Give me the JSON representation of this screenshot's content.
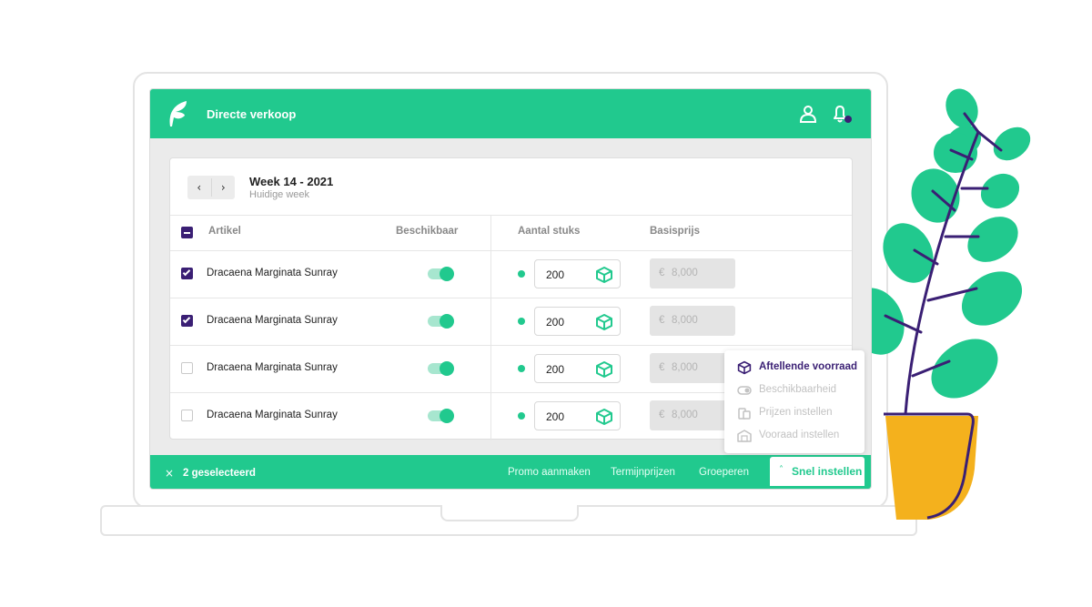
{
  "app": {
    "title": "Directe verkoop"
  },
  "week": {
    "title": "Week 14 - 2021",
    "subtitle": "Huidige week",
    "prev": "‹",
    "next": "›"
  },
  "table": {
    "columns": [
      "Artikel",
      "Beschikbaar",
      "Aantal stuks",
      "Basisprijs"
    ],
    "rows": [
      {
        "selected": true,
        "name": "Dracaena Marginata Sunray",
        "available": true,
        "quantity": "200",
        "currency": "€",
        "price": "8,000"
      },
      {
        "selected": true,
        "name": "Dracaena Marginata Sunray",
        "available": true,
        "quantity": "200",
        "currency": "€",
        "price": "8,000"
      },
      {
        "selected": false,
        "name": "Dracaena Marginata Sunray",
        "available": true,
        "quantity": "200",
        "currency": "€",
        "price": "8,000"
      },
      {
        "selected": false,
        "name": "Dracaena Marginata Sunray",
        "available": true,
        "quantity": "200",
        "currency": "€",
        "price": "8,000"
      }
    ]
  },
  "bottombar": {
    "close": "×",
    "selected": "2 geselecteerd",
    "links": [
      "Promo aanmaken",
      "Termijnprijzen",
      "Groeperen"
    ],
    "quick_chevron": "˄",
    "quick": "Snel instellen"
  },
  "menu": {
    "items": [
      {
        "label": "Aftellende voorraad",
        "icon": "box-icon",
        "active": true
      },
      {
        "label": "Beschikbaarheid",
        "icon": "toggle-icon",
        "active": false
      },
      {
        "label": "Prijzen instellen",
        "icon": "coins-icon",
        "active": false
      },
      {
        "label": "Vooraad instellen",
        "icon": "warehouse-icon",
        "active": false
      }
    ]
  },
  "colors": {
    "brand": "#21c98e",
    "accent": "#3a1f74",
    "pot": "#f4b11d"
  }
}
